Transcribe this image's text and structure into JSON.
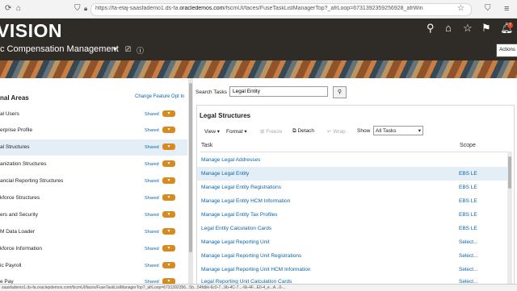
{
  "browser": {
    "url_prefix": "https://fa-etaj-saasfademo1.ds-fa.",
    "url_domain": "oracledemos.com",
    "url_suffix": "/fscmUI/faces/FuseTaskListManagerTop?_afrLoop=67313923592569​28_afrWin",
    "status_url": "saasfademo1.ds-fa.oraclepdemos.com/fscmUI/faces/FuseTaskListManagerTop?_afrLoop=6731392356...5b...54fdbk-6c0-7...9b-4C-7...-6k-4F...E0-4_e...A...0-..."
  },
  "header": {
    "logo": "VISION",
    "app_title": "c Compensation Management",
    "actions_label": "Actions",
    "notification_count": "7"
  },
  "left": {
    "title": "nal Areas",
    "change_link": "Change Feature Opt In",
    "shared_label": "Shared",
    "items": [
      {
        "label": "al Users"
      },
      {
        "label": "erprise Profile"
      },
      {
        "label": "al Structures"
      },
      {
        "label": "anization Structures"
      },
      {
        "label": "ancial Reporting Structures"
      },
      {
        "label": "kforce Structures"
      },
      {
        "label": "ers and Security"
      },
      {
        "label": "M Data Loader"
      },
      {
        "label": "kforce Information"
      },
      {
        "label": "ic Payroll"
      },
      {
        "label": "e Pay"
      }
    ]
  },
  "search": {
    "label": "Search Tasks",
    "value": "Legal Entity"
  },
  "panel": {
    "title": "Legal Structures",
    "toolbar": {
      "view": "View",
      "format": "Format",
      "freeze": "Freeze",
      "detach": "Detach",
      "wrap": "Wrap",
      "show": "Show",
      "show_value": "All Tasks"
    },
    "columns": {
      "task": "Task",
      "scope": "Scope"
    },
    "rows": [
      {
        "task": "Manage Legal Addresses",
        "scope": ""
      },
      {
        "task": "Manage Legal Entity",
        "scope": "EBS LE"
      },
      {
        "task": "Manage Legal Entity Registrations",
        "scope": "EBS LE"
      },
      {
        "task": "Manage Legal Entity HCM Information",
        "scope": "EBS LE"
      },
      {
        "task": "Manage Legal Entity Tax Profiles",
        "scope": "EBS LE"
      },
      {
        "task": "Legal Entity Calculation Cards",
        "scope": "EBS LE"
      },
      {
        "task": "Manage Legal Reporting Unit",
        "scope": "Select..."
      },
      {
        "task": "Manage Legal Reporting Unit Registrations",
        "scope": "Select..."
      },
      {
        "task": "Manage Legal Reporting Unit HCM Information",
        "scope": "Select..."
      },
      {
        "task": "Legal Reporting Unit Calculation Cards",
        "scope": "Select..."
      }
    ]
  }
}
